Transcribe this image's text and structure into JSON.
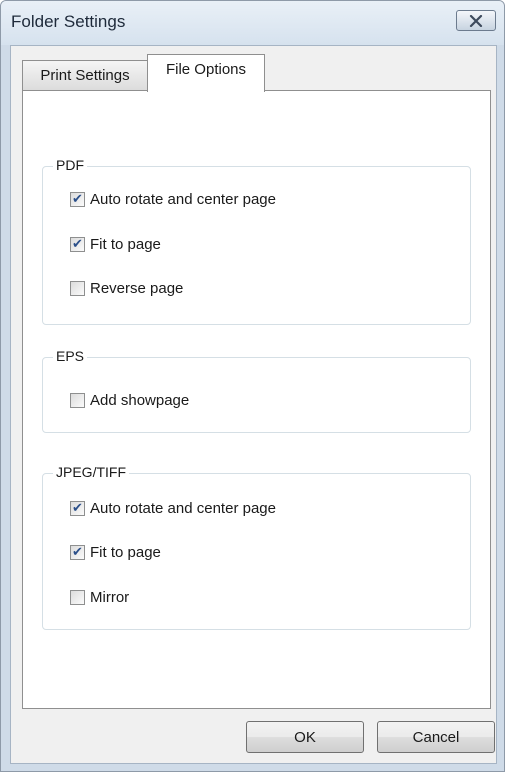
{
  "window": {
    "title": "Folder Settings"
  },
  "icons": {
    "close": "close-icon"
  },
  "tabs": [
    {
      "label": "Print Settings",
      "active": false
    },
    {
      "label": "File Options",
      "active": true
    }
  ],
  "groups": {
    "pdf": {
      "label": "PDF",
      "options": [
        {
          "label": "Auto rotate and center page",
          "checked": true
        },
        {
          "label": "Fit to page",
          "checked": true
        },
        {
          "label": "Reverse page",
          "checked": false
        }
      ]
    },
    "eps": {
      "label": "EPS",
      "options": [
        {
          "label": "Add showpage",
          "checked": false
        }
      ]
    },
    "jpeg_tiff": {
      "label": "JPEG/TIFF",
      "options": [
        {
          "label": "Auto rotate and center page",
          "checked": true
        },
        {
          "label": "Fit to page",
          "checked": true
        },
        {
          "label": "Mirror",
          "checked": false
        }
      ]
    }
  },
  "buttons": {
    "ok": "OK",
    "cancel": "Cancel"
  },
  "colors": {
    "check_mark": "#2b4f8a",
    "title_bar": "#d6e2ee"
  }
}
